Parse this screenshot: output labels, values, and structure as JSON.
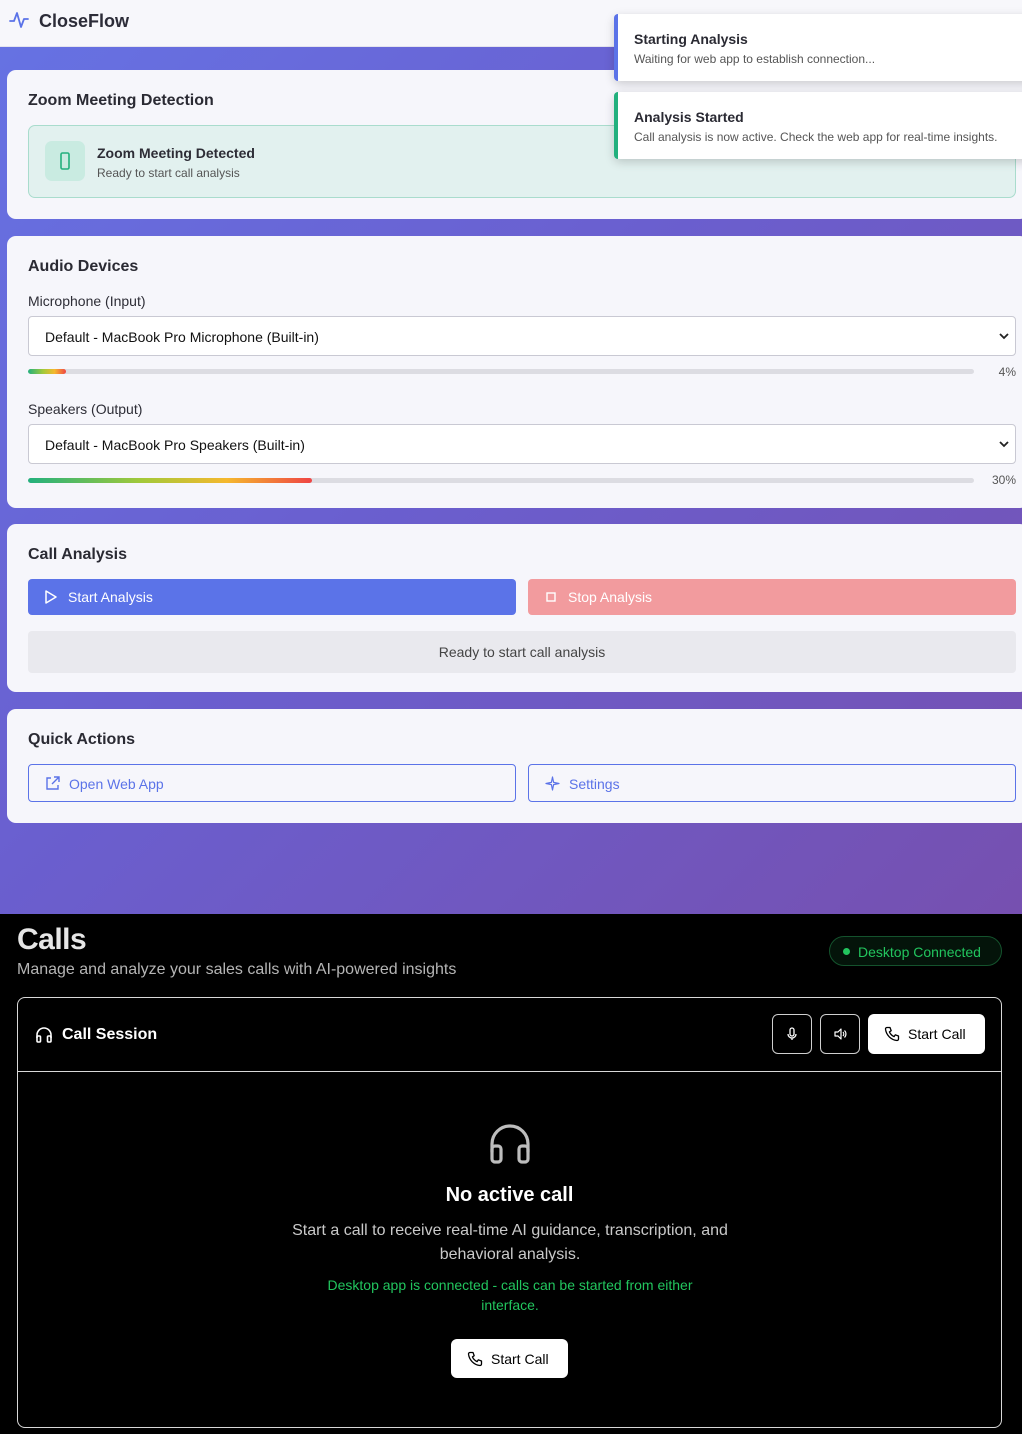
{
  "app": {
    "name": "CloseFlow"
  },
  "zoom": {
    "title": "Zoom Meeting Detection",
    "status_title": "Zoom Meeting Detected",
    "status_sub": "Ready to start call analysis"
  },
  "audio": {
    "title": "Audio Devices",
    "mic_label": "Microphone (Input)",
    "mic_value": "Default - MacBook Pro Microphone (Built-in)",
    "mic_level": 4,
    "mic_level_text": "4%",
    "speaker_label": "Speakers (Output)",
    "speaker_value": "Default - MacBook Pro Speakers (Built-in)",
    "speaker_level": 30,
    "speaker_level_text": "30%"
  },
  "analysis": {
    "title": "Call Analysis",
    "start_label": "Start Analysis",
    "stop_label": "Stop Analysis",
    "status": "Ready to start call analysis"
  },
  "quick": {
    "title": "Quick Actions",
    "open_web": "Open Web App",
    "settings": "Settings"
  },
  "toasts": [
    {
      "title": "Starting Analysis",
      "message": "Waiting for web app to establish connection...",
      "color": "#5b73e8"
    },
    {
      "title": "Analysis Started",
      "message": "Call analysis is now active. Check the web app for real-time insights.",
      "color": "#22b07d"
    }
  ],
  "web": {
    "title": "Calls",
    "subtitle": "Manage and analyze your sales calls with AI-powered insights",
    "badge": "Desktop Connected",
    "session_title": "Call Session",
    "start_call": "Start Call",
    "empty_title": "No active call",
    "empty_desc": "Start a call to receive real-time AI guidance, transcription, and behavioral analysis.",
    "empty_note": "Desktop app is connected - calls can be started from either interface.",
    "empty_button": "Start Call"
  },
  "colors": {
    "accent": "#5b73e8",
    "stop": "#f29b9e",
    "success": "#22c55e"
  }
}
